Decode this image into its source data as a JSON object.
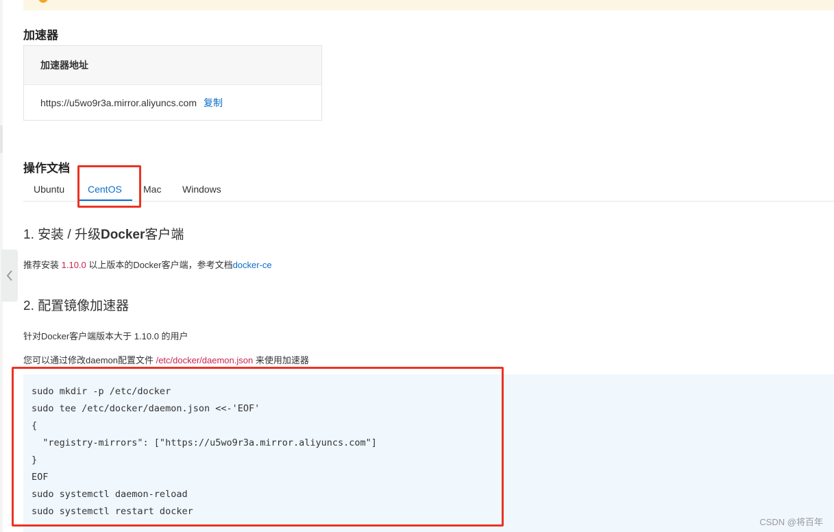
{
  "accelerator": {
    "title": "加速器",
    "table_header": "加速器地址",
    "url": "https://u5wo9r3a.mirror.aliyuncs.com",
    "copy_label": "复制"
  },
  "docs": {
    "title": "操作文档",
    "tabs": [
      {
        "label": "Ubuntu",
        "active": false
      },
      {
        "label": "CentOS",
        "active": true
      },
      {
        "label": "Mac",
        "active": false
      },
      {
        "label": "Windows",
        "active": false
      }
    ]
  },
  "step1": {
    "title_prefix": "1. 安装 / 升级",
    "title_bold": "Docker",
    "title_suffix": "客户端",
    "text_prefix": "推荐安装 ",
    "version": "1.10.0",
    "text_middle": " 以上版本的Docker客户端，参考文档",
    "doc_link": "docker-ce"
  },
  "step2": {
    "title": "2. 配置镜像加速器",
    "line1": "针对Docker客户端版本大于 1.10.0 的用户",
    "line2_prefix": "您可以通过修改daemon配置文件 ",
    "config_path": "/etc/docker/daemon.json",
    "line2_suffix": " 来使用加速器"
  },
  "code_lines": [
    "sudo mkdir -p /etc/docker",
    "sudo tee /etc/docker/daemon.json <<-'EOF'",
    "{",
    "  \"registry-mirrors\": [\"https://u5wo9r3a.mirror.aliyuncs.com\"]",
    "}",
    "EOF",
    "sudo systemctl daemon-reload",
    "sudo systemctl restart docker"
  ],
  "watermark": "CSDN @将百年",
  "colors": {
    "link_blue": "#0b6fca",
    "accent_red": "#c7254e",
    "highlight_box": "#ea3323",
    "code_bg": "#f0f7fd"
  }
}
